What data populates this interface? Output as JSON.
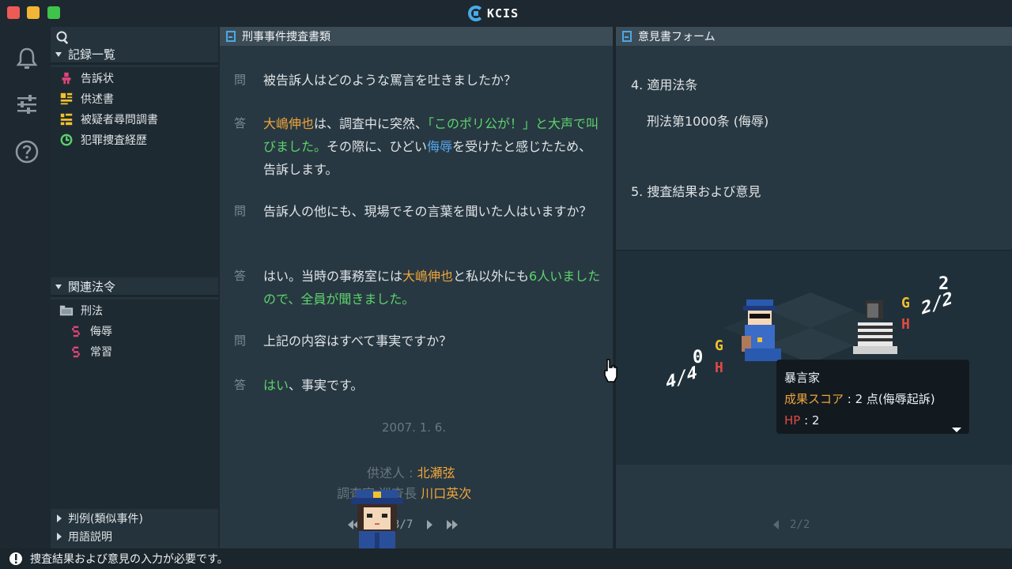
{
  "app": {
    "logo_text": "KCIS"
  },
  "sidebar": {
    "records_header": "記録一覧",
    "records": [
      {
        "label": "告訴状",
        "icon": "person-icon"
      },
      {
        "label": "供述書",
        "icon": "statement-icon"
      },
      {
        "label": "被疑者尋問調書",
        "icon": "interrogation-icon"
      },
      {
        "label": "犯罪捜査経歴",
        "icon": "history-icon"
      }
    ],
    "laws_header": "関連法令",
    "laws_root": "刑法",
    "laws": [
      {
        "label": "侮辱"
      },
      {
        "label": "常習"
      }
    ],
    "precedents": "判例(類似事件)",
    "glossary": "用語説明"
  },
  "left_pane": {
    "title": "刑事事件捜査書類",
    "q_label": "問",
    "a_label": "答",
    "q1": "被告訴人はどのような罵言を吐きましたか？",
    "a1": {
      "name": "大嶋伸也",
      "p1": "は、調査中に突然、",
      "quote": "「このポリ公が！」と大声で叫びました。",
      "p2": "その際に、ひどい",
      "insult": "侮辱",
      "p3": "を受けたと感じたため、告訴します。"
    },
    "q2": "告訴人の他にも、現場でその言葉を聞いた人はいますか？",
    "a2": {
      "p1": "はい。当時の事務室には",
      "name": "大嶋伸也",
      "p2": "と私以外にも",
      "count": "6人いましたので、全員が聞きました。"
    },
    "q3": "上記の内容はすべて事実ですか？",
    "a3": {
      "yes": "はい",
      "rest": "、事実です。"
    },
    "date": "2007. 1. 6.",
    "sig_label1": "供述人 : ",
    "sig_name1": "北瀬弦",
    "sig_label2": "調査官 巡査長 ",
    "sig_name2": "川口英次",
    "page": "3/7"
  },
  "right_pane": {
    "title": "意見書フォーム",
    "section4": "4. 適用法条",
    "law": "刑法第1000条 (侮辱)",
    "section5": "5. 捜査結果および意見",
    "page": "2/2"
  },
  "board": {
    "left_top": "0",
    "left_bottom": "4/4",
    "right_top": "2",
    "right_bottom": "2/2",
    "letter_g": "G",
    "letter_h": "H"
  },
  "tooltip": {
    "title": "暴言家",
    "score_label": "成果スコア",
    "score_value": " : 2 点(侮辱起訴)",
    "hp_label": "HP",
    "hp_value": " : 2"
  },
  "status": {
    "message": "捜査結果および意見の入力が必要です。"
  },
  "colors": {
    "accent_blue": "#4aa9e8",
    "orange": "#f0a53a",
    "green": "#5cd46c",
    "red": "#e04a44"
  }
}
